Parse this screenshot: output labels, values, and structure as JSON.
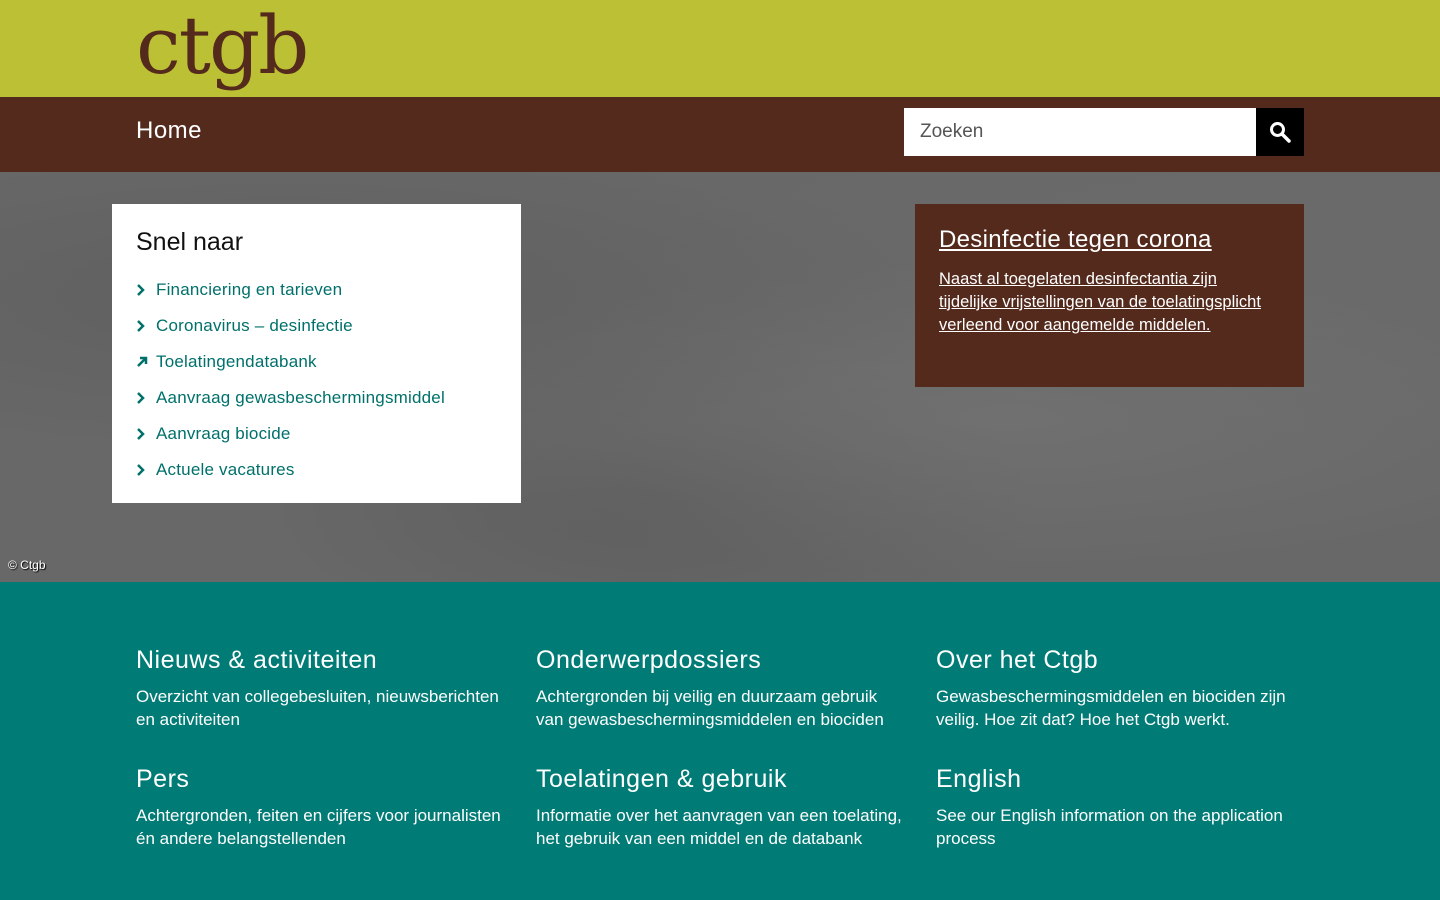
{
  "header": {
    "logo": "ctgb"
  },
  "nav": {
    "home": "Home",
    "search_placeholder": "Zoeken"
  },
  "snel_naar": {
    "title": "Snel naar",
    "items": [
      {
        "label": "Financiering en tarieven",
        "icon": "chevron-right-icon"
      },
      {
        "label": "Coronavirus – desinfectie",
        "icon": "chevron-right-icon"
      },
      {
        "label": "Toelatingendatabank",
        "icon": "external-link-arrow-icon"
      },
      {
        "label": "Aanvraag gewasbeschermingsmiddel",
        "icon": "chevron-right-icon"
      },
      {
        "label": "Aanvraag biocide",
        "icon": "chevron-right-icon"
      },
      {
        "label": "Actuele vacatures",
        "icon": "chevron-right-icon"
      }
    ]
  },
  "corona": {
    "title": "Desinfectie tegen corona",
    "text": "Naast al toegelaten desinfectantia zijn tijdelijke vrijstellingen van de toelatingsplicht verleend voor aangemelde middelen."
  },
  "hero": {
    "copyright": "© Ctgb"
  },
  "footer": [
    {
      "title": "Nieuws & activiteiten",
      "text": "Overzicht van collegebesluiten, nieuwsberichten en activiteiten"
    },
    {
      "title": "Onderwerpdossiers",
      "text": "Achtergronden bij veilig en duurzaam gebruik van gewasbeschermingsmiddelen en biociden"
    },
    {
      "title": "Over het Ctgb",
      "text": "Gewasbeschermingsmiddelen en biociden zijn veilig. Hoe zit dat? Hoe het Ctgb werkt."
    },
    {
      "title": "Pers",
      "text": "Achtergronden, feiten en cijfers voor journalisten én andere belangstellenden"
    },
    {
      "title": "Toelatingen & gebruik",
      "text": "Informatie over het aanvragen van een toelating, het gebruik van een middel en de databank"
    },
    {
      "title": "English",
      "text": "See our English information on the application process"
    }
  ],
  "colors": {
    "lime": "#bcc034",
    "brown": "#542a1d",
    "teal": "#007b76",
    "link": "#00706b"
  }
}
